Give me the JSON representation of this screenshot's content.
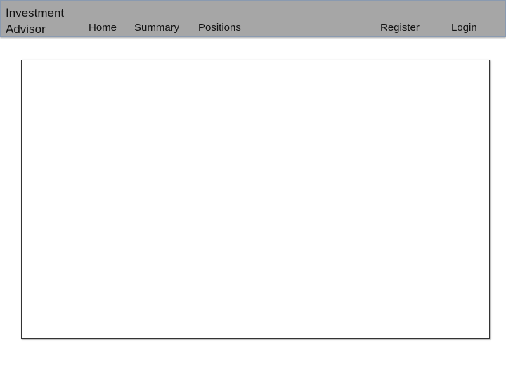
{
  "navbar": {
    "brand": {
      "line1": "Investment",
      "line2": "Advisor"
    },
    "links": {
      "home": "Home",
      "summary": "Summary",
      "positions": "Positions",
      "register": "Register",
      "login": "Login"
    }
  }
}
